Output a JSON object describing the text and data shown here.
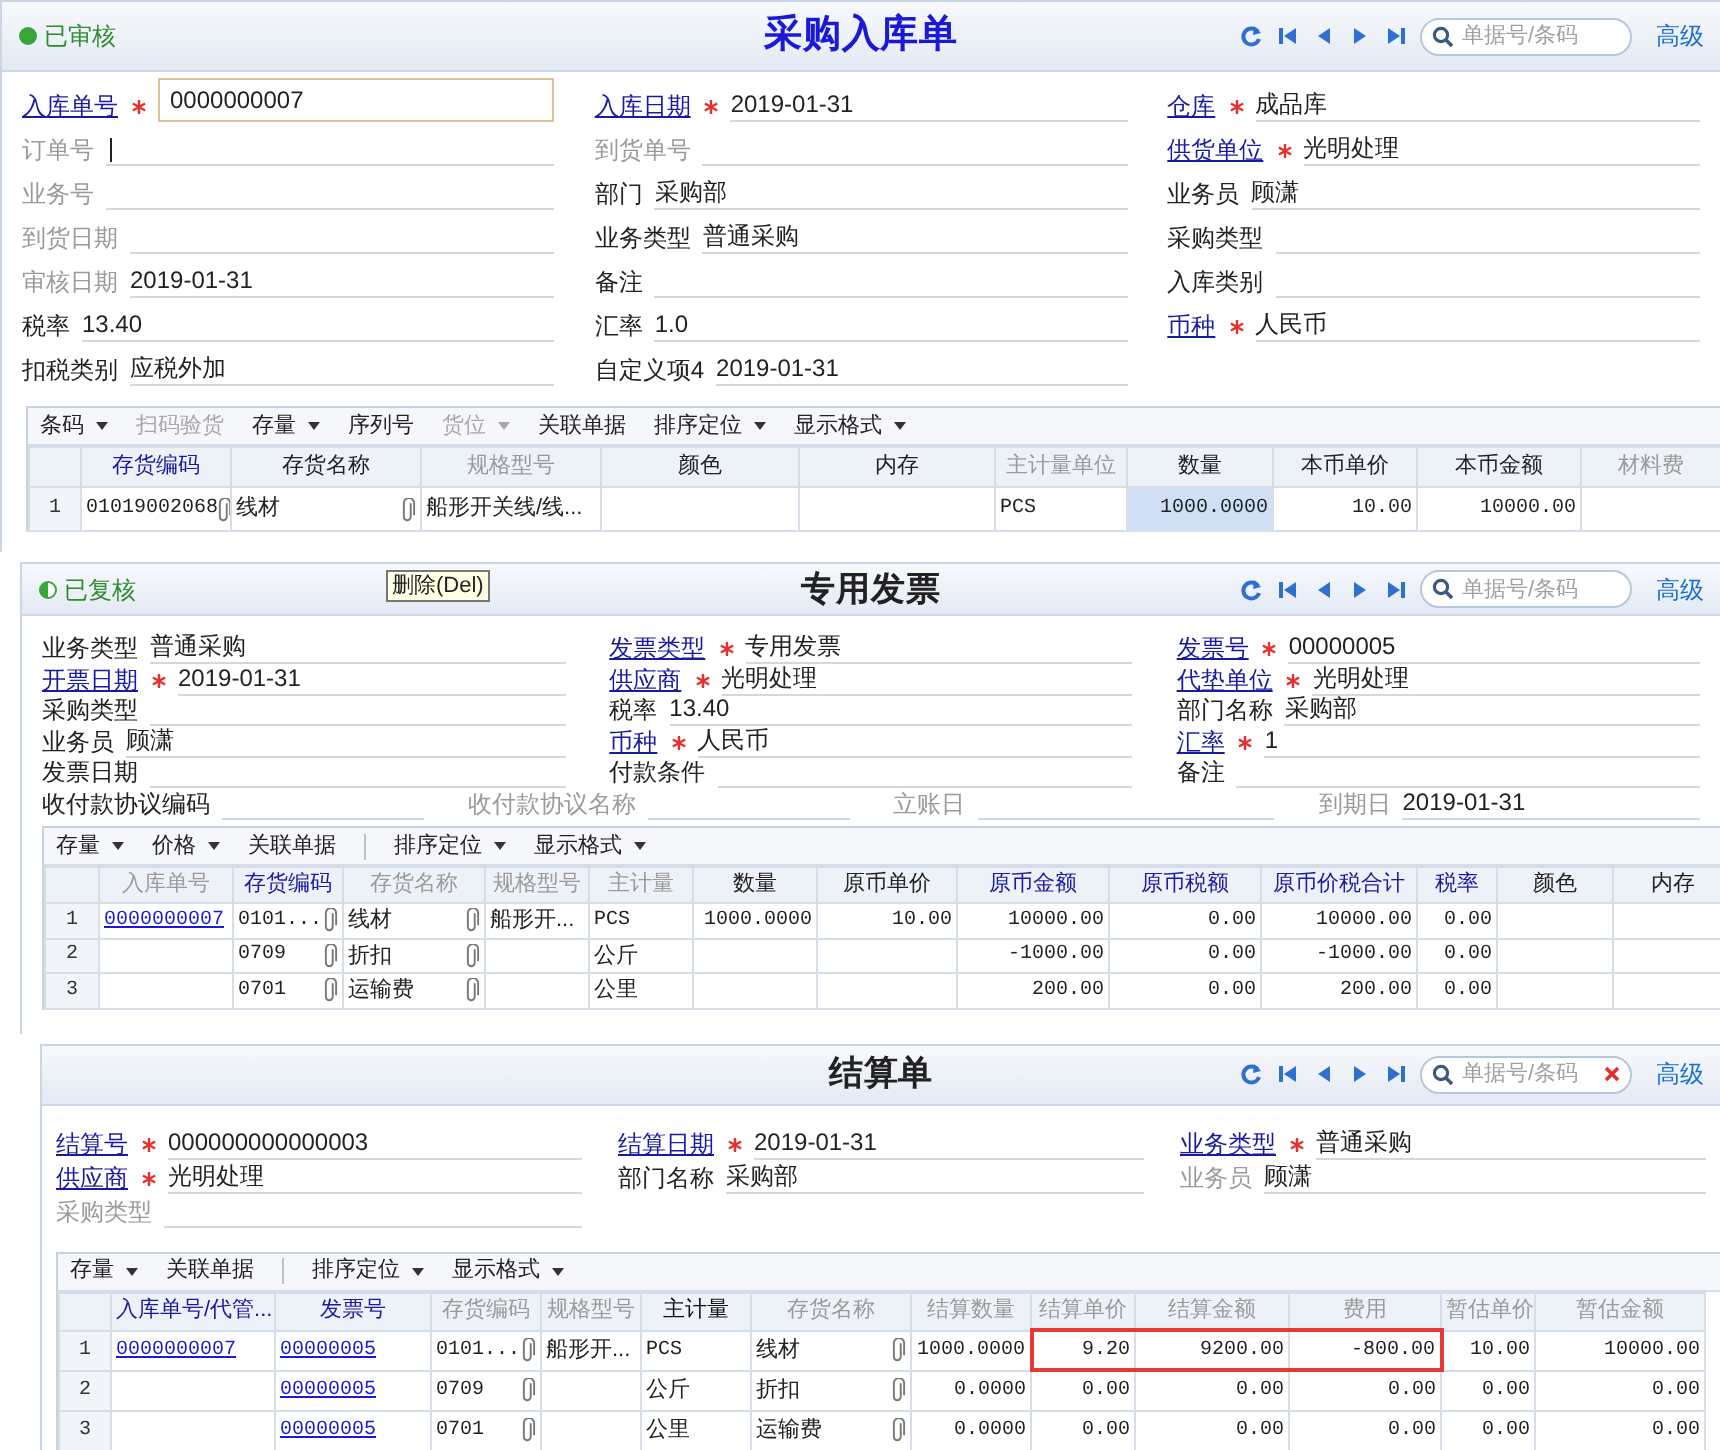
{
  "panels": [
    {
      "status": {
        "kind": "approved",
        "label": "已审核"
      },
      "title": "采购入库单",
      "color": "#1a1ad6",
      "search": {
        "placeholder": "单据号/条码",
        "clearable": false
      },
      "advanced": "高级",
      "form_rows": [
        [
          {
            "label": "入库单号",
            "kind": "link",
            "required": true,
            "value": "0000000007",
            "focused": true,
            "caret": false
          },
          {
            "label": "入库日期",
            "kind": "link",
            "required": true,
            "value": "2019-01-31",
            "focused": false,
            "caret": false
          },
          {
            "label": "仓库",
            "kind": "link",
            "required": true,
            "value": "成品库",
            "focused": false,
            "caret": false
          }
        ],
        [
          {
            "label": "订单号",
            "kind": "muted",
            "required": false,
            "focused": false,
            "caret": true
          },
          {
            "label": "到货单号",
            "kind": "muted",
            "required": false,
            "focused": false,
            "caret": false
          },
          {
            "label": "供货单位",
            "kind": "link",
            "required": true,
            "value": "光明处理",
            "focused": false,
            "caret": false
          }
        ],
        [
          {
            "label": "业务号",
            "kind": "muted",
            "required": false,
            "focused": false,
            "caret": false
          },
          {
            "label": "部门",
            "kind": "plain",
            "required": false,
            "value": "采购部",
            "focused": false,
            "caret": false
          },
          {
            "label": "业务员",
            "kind": "plain",
            "required": false,
            "value": "顾潇",
            "focused": false,
            "caret": false
          }
        ],
        [
          {
            "label": "到货日期",
            "kind": "muted",
            "required": false,
            "focused": false,
            "caret": false
          },
          {
            "label": "业务类型",
            "kind": "plain",
            "required": false,
            "value": "普通采购",
            "focused": false,
            "caret": false
          },
          {
            "label": "采购类型",
            "kind": "plain",
            "required": false,
            "focused": false,
            "caret": false
          }
        ],
        [
          {
            "label": "审核日期",
            "kind": "muted",
            "required": false,
            "value": "2019-01-31",
            "focused": false,
            "caret": false
          },
          {
            "label": "备注",
            "kind": "plain",
            "required": false,
            "focused": false,
            "caret": false
          },
          {
            "label": "入库类别",
            "kind": "plain",
            "required": false,
            "focused": false,
            "caret": false
          }
        ],
        [
          {
            "label": "税率",
            "kind": "plain",
            "required": false,
            "value": "13.40",
            "focused": false,
            "caret": false
          },
          {
            "label": "汇率",
            "kind": "plain",
            "required": false,
            "value": "1.0",
            "focused": false,
            "caret": false
          },
          {
            "label": "币种",
            "kind": "link",
            "required": true,
            "value": "人民币",
            "focused": false,
            "caret": false
          }
        ],
        [
          {
            "label": "扣税类别",
            "kind": "plain",
            "required": false,
            "value": "应税外加",
            "focused": false,
            "caret": false
          },
          {
            "label": "自定义项4",
            "kind": "plain",
            "required": false,
            "value": "2019-01-31",
            "focused": false,
            "caret": false
          }
        ]
      ],
      "toolbar": [
        {
          "kind": "button",
          "label": "条码",
          "dropdown": true,
          "disabled": false
        },
        {
          "kind": "button",
          "label": "扫码验货",
          "dropdown": false,
          "disabled": true
        },
        {
          "kind": "button",
          "label": "存量",
          "dropdown": true,
          "disabled": false
        },
        {
          "kind": "button",
          "label": "序列号",
          "dropdown": false,
          "disabled": false
        },
        {
          "kind": "button",
          "label": "货位",
          "dropdown": true,
          "disabled": true
        },
        {
          "kind": "button",
          "label": "关联单据",
          "dropdown": false,
          "disabled": false
        },
        {
          "kind": "button",
          "label": "排序定位",
          "dropdown": true,
          "disabled": false
        },
        {
          "kind": "button",
          "label": "显示格式",
          "dropdown": true,
          "disabled": false
        }
      ],
      "columns": [
        {
          "label": "存货编码",
          "color": "#1a1a9e",
          "kind": "text",
          "clip": true,
          "selected": false
        },
        {
          "label": "存货名称",
          "color": "#222222",
          "kind": "text",
          "clip": true,
          "selected": false
        },
        {
          "label": "规格型号",
          "color": "#9a9a9a",
          "kind": "text",
          "selected": false
        },
        {
          "label": "颜色",
          "color": "#222222",
          "kind": "text",
          "selected": false
        },
        {
          "label": "内存",
          "color": "#222222",
          "kind": "text",
          "selected": false
        },
        {
          "label": "主计量单位",
          "color": "#9a9a9a",
          "kind": "text",
          "selected": false
        },
        {
          "label": "数量",
          "color": "#222222",
          "kind": "number",
          "selected": true
        },
        {
          "label": "本币单价",
          "color": "#222222",
          "kind": "number",
          "selected": false
        },
        {
          "label": "本币金额",
          "color": "#222222",
          "kind": "number",
          "selected": false
        },
        {
          "label": "材料费",
          "color": "#9a9a9a",
          "kind": "number",
          "selected": false
        }
      ],
      "rows": [
        {
          "num": "1",
          "cells": [
            "01019002068",
            "线材",
            "船形开关线/线...",
            null,
            null,
            "PCS",
            "1000.0000",
            "10.00",
            "10000.00",
            null
          ]
        }
      ]
    },
    {
      "status": {
        "kind": "reviewed",
        "label": "已复核"
      },
      "tooltip": "删除(Del)",
      "title": "专用发票",
      "color": "#222222",
      "search": {
        "placeholder": "单据号/条码",
        "clearable": false
      },
      "advanced": "高级",
      "form_rows": [
        [
          {
            "label": "业务类型",
            "kind": "plain",
            "required": false,
            "value": "普通采购",
            "focused": false,
            "caret": false
          },
          {
            "label": "发票类型",
            "kind": "link",
            "required": true,
            "value": "专用发票",
            "focused": false,
            "caret": false
          },
          {
            "label": "发票号",
            "kind": "link",
            "required": true,
            "value": "00000005",
            "focused": false,
            "caret": false
          }
        ],
        [
          {
            "label": "开票日期",
            "kind": "link",
            "required": true,
            "value": "2019-01-31",
            "focused": false,
            "caret": false
          },
          {
            "label": "供应商",
            "kind": "link",
            "required": true,
            "value": "光明处理",
            "focused": false,
            "caret": false
          },
          {
            "label": "代垫单位",
            "kind": "link",
            "required": true,
            "value": "光明处理",
            "focused": false,
            "caret": false
          }
        ],
        [
          {
            "label": "采购类型",
            "kind": "plain",
            "required": false,
            "focused": false,
            "caret": false
          },
          {
            "label": "税率",
            "kind": "plain",
            "required": false,
            "value": "13.40",
            "focused": false,
            "caret": false
          },
          {
            "label": "部门名称",
            "kind": "plain",
            "required": false,
            "value": "采购部",
            "focused": false,
            "caret": false
          }
        ],
        [
          {
            "label": "业务员",
            "kind": "plain",
            "required": false,
            "value": "顾潇",
            "focused": false,
            "caret": false
          },
          {
            "label": "币种",
            "kind": "link",
            "required": true,
            "value": "人民币",
            "focused": false,
            "caret": false
          },
          {
            "label": "汇率",
            "kind": "link",
            "required": true,
            "value": "1",
            "focused": false,
            "caret": false
          }
        ],
        [
          {
            "label": "发票日期",
            "kind": "plain",
            "required": false,
            "focused": false,
            "caret": false
          },
          {
            "label": "付款条件",
            "kind": "plain",
            "required": false,
            "focused": false,
            "caret": false
          },
          {
            "label": "备注",
            "kind": "plain",
            "required": false,
            "focused": false,
            "caret": false
          }
        ],
        [
          {
            "label": "收付款协议编码",
            "kind": "plain",
            "required": false,
            "focused": false,
            "caret": false
          },
          {
            "label": "收付款协议名称",
            "kind": "muted",
            "required": false,
            "focused": false,
            "caret": false
          },
          {
            "label": "立账日",
            "kind": "muted",
            "required": false,
            "focused": false,
            "caret": false
          },
          {
            "label": "到期日",
            "kind": "muted",
            "required": false,
            "value": "2019-01-31",
            "focused": false,
            "caret": false
          }
        ]
      ],
      "toolbar": [
        {
          "kind": "button",
          "label": "存量",
          "dropdown": true,
          "disabled": false
        },
        {
          "kind": "button",
          "label": "价格",
          "dropdown": true,
          "disabled": false
        },
        {
          "kind": "button",
          "label": "关联单据",
          "dropdown": false,
          "disabled": false
        },
        {
          "kind": "separator"
        },
        {
          "kind": "button",
          "label": "排序定位",
          "dropdown": true,
          "disabled": false
        },
        {
          "kind": "button",
          "label": "显示格式",
          "dropdown": true,
          "disabled": false
        }
      ],
      "columns": [
        {
          "label": "入库单号",
          "color": "#9a9a9a",
          "kind": "link"
        },
        {
          "label": "存货编码",
          "color": "#1a1a9e",
          "kind": "text",
          "clip": true
        },
        {
          "label": "存货名称",
          "color": "#9a9a9a",
          "kind": "text",
          "clip": true
        },
        {
          "label": "规格型号",
          "color": "#9a9a9a",
          "kind": "text"
        },
        {
          "label": "主计量",
          "color": "#9a9a9a",
          "kind": "text"
        },
        {
          "label": "数量",
          "color": "#222222",
          "kind": "number"
        },
        {
          "label": "原币单价",
          "color": "#222222",
          "kind": "number"
        },
        {
          "label": "原币金额",
          "color": "#1a1a9e",
          "kind": "number"
        },
        {
          "label": "原币税额",
          "color": "#1a1a9e",
          "kind": "number"
        },
        {
          "label": "原币价税合计",
          "color": "#1a1a9e",
          "kind": "number"
        },
        {
          "label": "税率",
          "color": "#1a1a9e",
          "kind": "number"
        },
        {
          "label": "颜色",
          "color": "#222222",
          "kind": "text"
        },
        {
          "label": "内存",
          "color": "#222222",
          "kind": "text"
        }
      ],
      "rows": [
        {
          "num": "1",
          "cells": [
            "0000000007",
            "0101...",
            "线材",
            "船形开...",
            "PCS",
            "1000.0000",
            "10.00",
            "10000.00",
            "0.00",
            "10000.00",
            "0.00",
            null,
            null
          ]
        },
        {
          "num": "2",
          "cells": [
            null,
            "0709",
            "折扣",
            null,
            "公斤",
            null,
            null,
            "-1000.00",
            "0.00",
            "-1000.00",
            "0.00",
            null,
            null
          ]
        },
        {
          "num": "3",
          "cells": [
            null,
            "0701",
            "运输费",
            null,
            "公里",
            null,
            null,
            "200.00",
            "0.00",
            "200.00",
            "0.00",
            null,
            null
          ]
        }
      ]
    },
    {
      "title": "结算单",
      "color": "#222222",
      "search": {
        "placeholder": "单据号/条码",
        "clearable": true
      },
      "advanced": "高级",
      "form_rows": [
        [
          {
            "label": "结算号",
            "kind": "link",
            "required": true,
            "value": "000000000000003",
            "focused": false,
            "caret": false
          },
          {
            "label": "结算日期",
            "kind": "link",
            "required": true,
            "value": "2019-01-31",
            "focused": false,
            "caret": false
          },
          {
            "label": "业务类型",
            "kind": "link",
            "required": true,
            "value": "普通采购",
            "focused": false,
            "caret": false
          }
        ],
        [
          {
            "label": "供应商",
            "kind": "link",
            "required": true,
            "value": "光明处理",
            "focused": false,
            "caret": false
          },
          {
            "label": "部门名称",
            "kind": "plain",
            "required": false,
            "value": "采购部",
            "focused": false,
            "caret": false
          },
          {
            "label": "业务员",
            "kind": "muted",
            "required": false,
            "value": "顾潇",
            "focused": false,
            "caret": false
          }
        ],
        [
          {
            "label": "采购类型",
            "kind": "muted",
            "required": false,
            "focused": false,
            "caret": false
          }
        ]
      ],
      "toolbar": [
        {
          "kind": "button",
          "label": "存量",
          "dropdown": true,
          "disabled": false
        },
        {
          "kind": "button",
          "label": "关联单据",
          "dropdown": false,
          "disabled": false
        },
        {
          "kind": "separator"
        },
        {
          "kind": "button",
          "label": "排序定位",
          "dropdown": true,
          "disabled": false
        },
        {
          "kind": "button",
          "label": "显示格式",
          "dropdown": true,
          "disabled": false
        }
      ],
      "columns": [
        {
          "label": "入库单号/代管...",
          "color": "#1a1a9e",
          "kind": "link",
          "boxed": false
        },
        {
          "label": "发票号",
          "color": "#1a1a9e",
          "kind": "link",
          "boxed": false
        },
        {
          "label": "存货编码",
          "color": "#9a9a9a",
          "kind": "text",
          "clip": true,
          "boxed": false
        },
        {
          "label": "规格型号",
          "color": "#9a9a9a",
          "kind": "text",
          "boxed": false
        },
        {
          "label": "主计量",
          "color": "#111111",
          "kind": "text",
          "boxed": false
        },
        {
          "label": "存货名称",
          "color": "#9a9a9a",
          "kind": "text",
          "clip": true,
          "boxed": false
        },
        {
          "label": "结算数量",
          "color": "#9a9a9a",
          "kind": "number",
          "boxed": false
        },
        {
          "label": "结算单价",
          "color": "#9a9a9a",
          "kind": "number",
          "boxed": true
        },
        {
          "label": "结算金额",
          "color": "#9a9a9a",
          "kind": "number",
          "boxed": true
        },
        {
          "label": "费用",
          "color": "#9a9a9a",
          "kind": "number",
          "boxed": true
        },
        {
          "label": "暂估单价",
          "color": "#9a9a9a",
          "kind": "number",
          "boxed": false
        },
        {
          "label": "暂估金额",
          "color": "#9a9a9a",
          "kind": "number",
          "boxed": false
        }
      ],
      "rows": [
        {
          "num": "1",
          "boxed": true,
          "cells": [
            "0000000007",
            "00000005",
            "0101...",
            "船形开...",
            "PCS",
            "线材",
            "1000.0000",
            "9.20",
            "9200.00",
            "-800.00",
            "10.00",
            "10000.00"
          ]
        },
        {
          "num": "2",
          "boxed": false,
          "cells": [
            null,
            "00000005",
            "0709",
            null,
            "公斤",
            "折扣",
            "0.0000",
            "0.00",
            "0.00",
            "0.00",
            "0.00",
            "0.00"
          ]
        },
        {
          "num": "3",
          "boxed": false,
          "cells": [
            null,
            "00000005",
            "0701",
            null,
            "公里",
            "运输费",
            "0.0000",
            "0.00",
            "0.00",
            "0.00",
            "0.00",
            "0.00"
          ]
        }
      ]
    }
  ]
}
